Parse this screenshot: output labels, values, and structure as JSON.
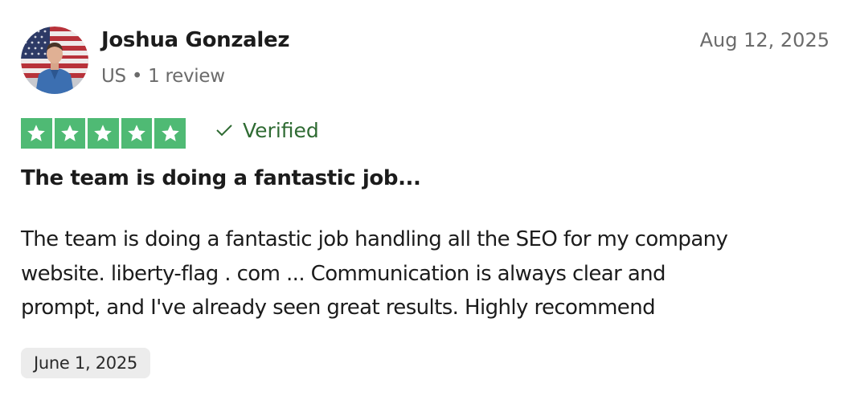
{
  "reviewer": {
    "name": "Joshua Gonzalez",
    "meta": "US • 1 review"
  },
  "review": {
    "date": "Aug 12, 2025",
    "rating": 5,
    "rating_max": 5,
    "star_color": "#4fba74",
    "verified_label": "Verified",
    "verified_color": "#2f6b33",
    "title": "The team is doing a fantastic job...",
    "body_lines": [
      "The team is doing a fantastic job handling all the SEO for my company",
      "website. liberty-flag . com ... Communication is always clear and",
      "prompt, and I've already seen great results. Highly recommend"
    ],
    "experience_date": "June 1, 2025"
  },
  "icons": {
    "avatar": "avatar-photo",
    "star": "star-icon",
    "verified": "checkmark-icon"
  }
}
